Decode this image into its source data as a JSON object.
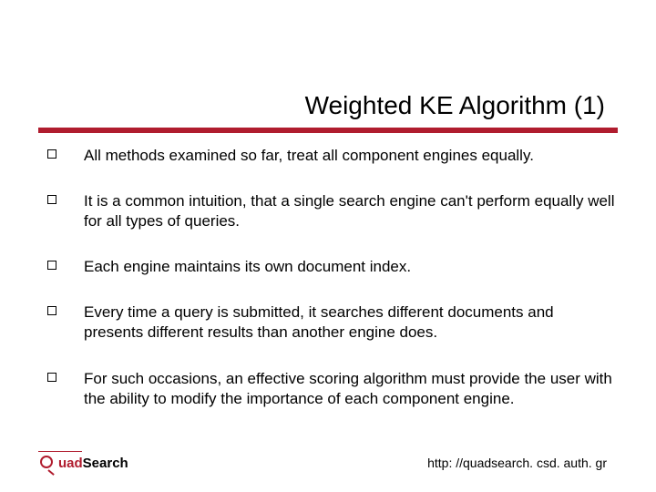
{
  "title": "Weighted KE Algorithm (1)",
  "bullets": [
    "All methods examined so far, treat all component engines equally.",
    "It is a common intuition, that a single search engine can't perform equally well for all types of queries.",
    "Each engine maintains its own document index.",
    "Every time a query is submitted, it searches different documents and presents different results than another engine does.",
    "For such occasions, an effective scoring algorithm must provide the user with the ability to modify the importance of each component engine."
  ],
  "footer": {
    "brand_part1": "uad",
    "brand_part2": "Search",
    "url": "http: //quadsearch. csd. auth. gr"
  }
}
